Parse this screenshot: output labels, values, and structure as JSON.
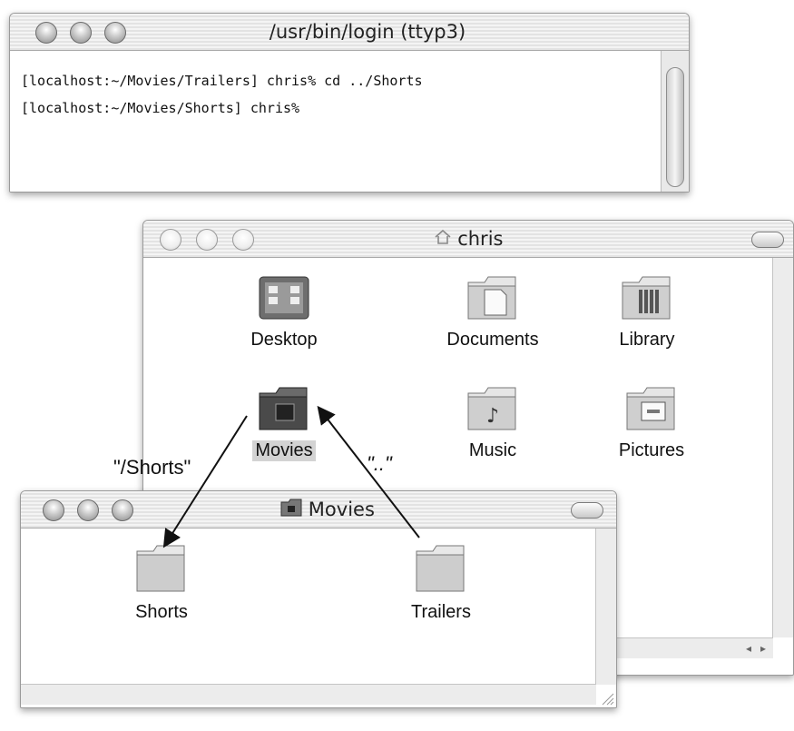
{
  "terminal": {
    "title": "/usr/bin/login  (ttyp3)",
    "lines": [
      "[localhost:~/Movies/Trailers] chris% cd ../Shorts",
      "[localhost:~/Movies/Shorts] chris%"
    ]
  },
  "finder_chris": {
    "title": "chris",
    "items": [
      {
        "label": "Desktop",
        "icon": "desktop-folder-icon"
      },
      {
        "label": "Documents",
        "icon": "documents-folder-icon"
      },
      {
        "label": "Library",
        "icon": "library-folder-icon"
      },
      {
        "label": "Movies",
        "icon": "movies-folder-icon",
        "selected": true
      },
      {
        "label": "Music",
        "icon": "music-folder-icon"
      },
      {
        "label": "Pictures",
        "icon": "pictures-folder-icon"
      }
    ]
  },
  "finder_movies": {
    "title": "Movies",
    "items": [
      {
        "label": "Shorts",
        "icon": "folder-icon"
      },
      {
        "label": "Trailers",
        "icon": "folder-icon"
      }
    ]
  },
  "annotations": {
    "shorts_path": "\"/Shorts\"",
    "parent_path": "\"..\""
  }
}
